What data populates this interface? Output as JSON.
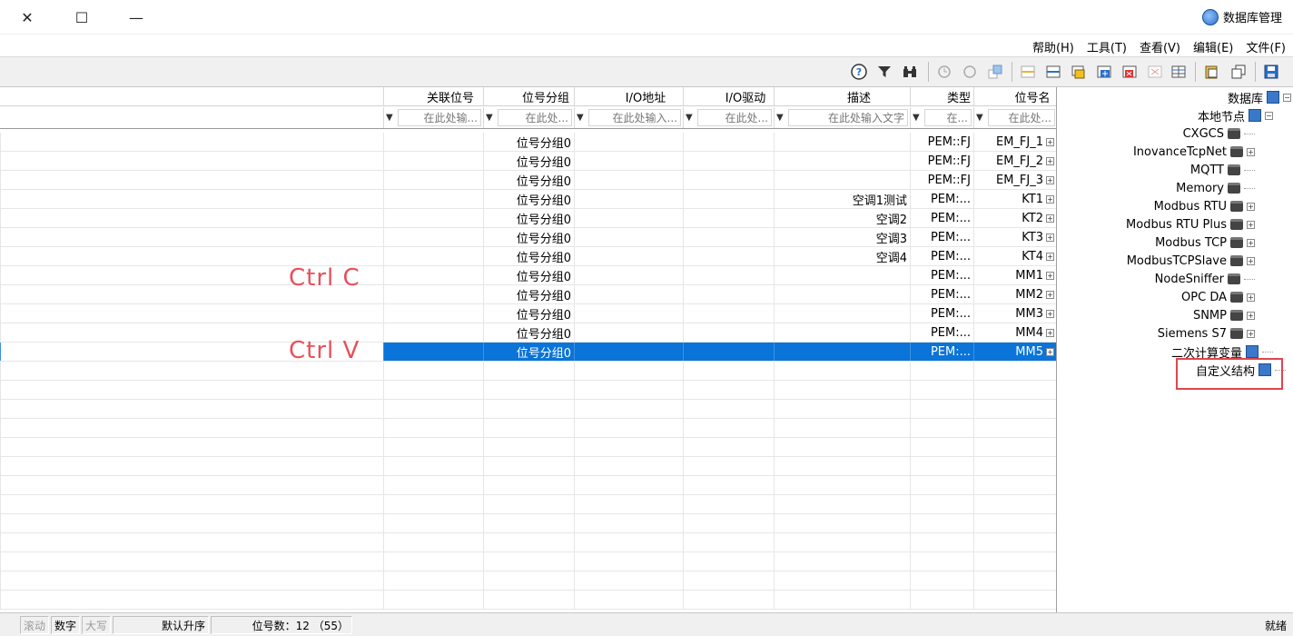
{
  "window": {
    "title": "数据库管理",
    "close_glyph": "✕",
    "max_glyph": "☐",
    "min_glyph": "—"
  },
  "menu": [
    "文件(F)",
    "编辑(E)",
    "查看(V)",
    "工具(T)",
    "帮助(H)"
  ],
  "toolbar_icons": [
    "save-icon",
    "copy-icon",
    "paste-icon",
    "grid-icon",
    "add-row-icon",
    "remove-row-icon",
    "delete-icon",
    "add-icon",
    "new-folder-icon",
    "insert-icon",
    "align-icon",
    "export-icon",
    "refresh-icon",
    "history-icon",
    "binoculars-icon",
    "filter-icon",
    "help-icon"
  ],
  "table": {
    "columns": [
      "位号名",
      "类型",
      "描述",
      "I/O驱动",
      "I/O地址",
      "位号分组",
      "关联位号"
    ],
    "filters": [
      "在此处...",
      "在...",
      "在此处输入文字",
      "在此处...",
      "在此处输入...",
      "在此处...",
      "在此处输..."
    ],
    "rows": [
      {
        "name": "EM_FJ_1",
        "type": "PEM::FJ",
        "desc": "",
        "group": "位号分组0"
      },
      {
        "name": "EM_FJ_2",
        "type": "PEM::FJ",
        "desc": "",
        "group": "位号分组0"
      },
      {
        "name": "EM_FJ_3",
        "type": "PEM::FJ",
        "desc": "",
        "group": "位号分组0"
      },
      {
        "name": "KT1",
        "type": "PEM:...",
        "desc": "空调1测试",
        "group": "位号分组0"
      },
      {
        "name": "KT2",
        "type": "PEM:...",
        "desc": "空调2",
        "group": "位号分组0"
      },
      {
        "name": "KT3",
        "type": "PEM:...",
        "desc": "空调3",
        "group": "位号分组0"
      },
      {
        "name": "KT4",
        "type": "PEM:...",
        "desc": "空调4",
        "group": "位号分组0"
      },
      {
        "name": "MM1",
        "type": "PEM:...",
        "desc": "",
        "group": "位号分组0"
      },
      {
        "name": "MM2",
        "type": "PEM:...",
        "desc": "",
        "group": "位号分组0"
      },
      {
        "name": "MM3",
        "type": "PEM:...",
        "desc": "",
        "group": "位号分组0"
      },
      {
        "name": "MM4",
        "type": "PEM:...",
        "desc": "",
        "group": "位号分组0"
      },
      {
        "name": "MM5",
        "type": "PEM:...",
        "desc": "",
        "group": "位号分组0",
        "selected": true
      }
    ],
    "expander": "+"
  },
  "annotations": {
    "copy": "Ctrl C",
    "paste": "Ctrl V",
    "color": "#e8505a"
  },
  "tree": {
    "root": "数据库",
    "local": "本地节点",
    "drivers": [
      "CXGCS",
      "InovanceTcpNet",
      "MQTT",
      "Memory",
      "Modbus RTU",
      "Modbus RTU Plus",
      "Modbus TCP",
      "ModbusTCPSlave",
      "NodeSniffer",
      "OPC DA",
      "SNMP",
      "Siemens S7"
    ],
    "expandable": [
      false,
      true,
      false,
      false,
      true,
      true,
      true,
      true,
      false,
      true,
      true,
      true
    ],
    "secondary": "二次计算变量",
    "custom": "自定义结构",
    "minus": "−",
    "plus": "+"
  },
  "status": {
    "ready": "就绪",
    "count": "位号数：12 （55）",
    "sort": "默认升序",
    "caps": "大写",
    "num": "数字",
    "scroll": "滚动"
  },
  "colors": {
    "selection": "#0a74d8",
    "highlight_box": "#e0454f"
  }
}
